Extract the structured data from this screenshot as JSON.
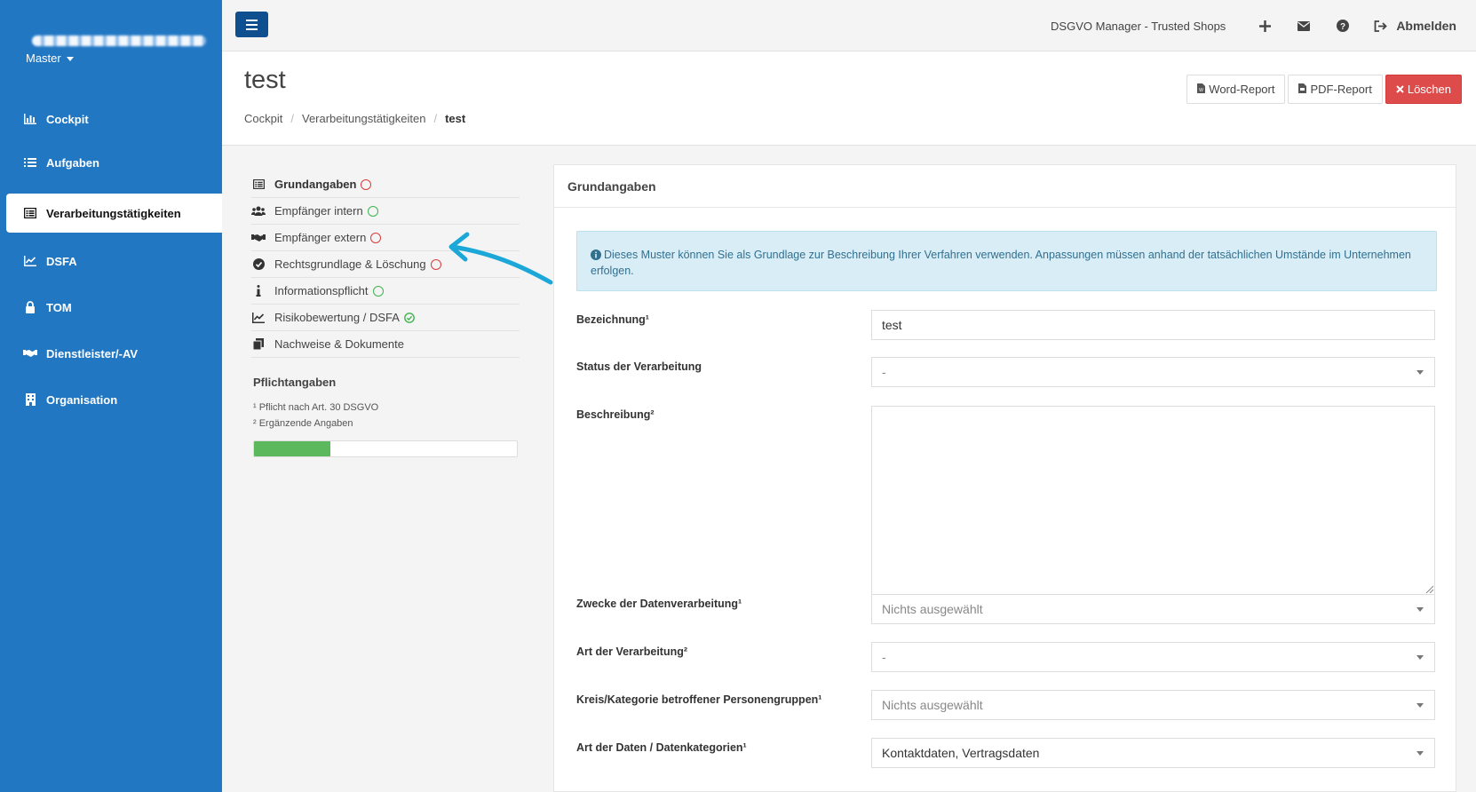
{
  "sidebar": {
    "user_menu": "Master",
    "items": [
      {
        "label": "Cockpit",
        "icon": "bar-chart-icon"
      },
      {
        "label": "Aufgaben",
        "icon": "tasks-icon"
      },
      {
        "label": "Verarbeitungstätigkeiten",
        "icon": "list-alt-icon",
        "active": true
      },
      {
        "label": "DSFA",
        "icon": "line-chart-icon"
      },
      {
        "label": "TOM",
        "icon": "lock-icon"
      },
      {
        "label": "Dienstleister/-AV",
        "icon": "handshake-icon"
      },
      {
        "label": "Organisation",
        "icon": "building-icon"
      }
    ]
  },
  "topbar": {
    "app_title": "DSGVO Manager - Trusted Shops",
    "logout_label": "Abmelden",
    "icons": [
      "plus-icon",
      "envelope-icon",
      "question-circle-icon",
      "sign-out-icon"
    ]
  },
  "header": {
    "title": "test",
    "breadcrumb": [
      "Cockpit",
      "Verarbeitungstätigkeiten",
      "test"
    ],
    "buttons": {
      "word": "Word-Report",
      "pdf": "PDF-Report",
      "delete": "Löschen"
    }
  },
  "subnav": {
    "items": [
      {
        "label": "Grundangaben",
        "status": "red",
        "icon": "list-alt-icon",
        "active": true
      },
      {
        "label": "Empfänger intern",
        "status": "green",
        "icon": "users-icon"
      },
      {
        "label": "Empfänger extern",
        "status": "red",
        "icon": "handshake-icon"
      },
      {
        "label": "Rechtsgrundlage & Löschung",
        "status": "red",
        "icon": "check-circle-icon"
      },
      {
        "label": "Informationspflicht",
        "status": "green",
        "icon": "info-icon"
      },
      {
        "label": "Risikobewertung / DSFA",
        "status": "check",
        "icon": "area-chart-icon"
      },
      {
        "label": "Nachweise & Dokumente",
        "status": "none",
        "icon": "files-icon"
      }
    ],
    "pflicht_title": "Pflichtangaben",
    "note1": "¹ Pflicht nach Art. 30 DSGVO",
    "note2": "² Ergänzende Angaben",
    "progress_percent": 29
  },
  "panel": {
    "title": "Grundangaben",
    "info": "Dieses Muster können Sie als Grundlage zur Beschreibung Ihrer Verfahren verwenden. Anpassungen müssen anhand der tatsächlichen Umstände im Unternehmen erfolgen.",
    "fields": {
      "bezeichnung_label": "Bezeichnung¹",
      "bezeichnung_value": "test",
      "status_label": "Status der Verarbeitung",
      "status_value": "-",
      "beschreibung_label": "Beschreibung²",
      "zwecke_label": "Zwecke der Datenverarbeitung¹",
      "zwecke_value": "Nichts ausgewählt",
      "art_label": "Art der Verarbeitung²",
      "art_value": "-",
      "kreis_label": "Kreis/Kategorie betroffener Personengruppen¹",
      "kreis_value": "Nichts ausgewählt",
      "daten_label": "Art der Daten / Datenkategorien¹",
      "daten_value": "Kontaktdaten, Vertragsdaten"
    }
  },
  "colors": {
    "sidebar": "#2277c3",
    "hamburger": "#0f4f8f",
    "danger": "#dd4b4b",
    "progress": "#5cb85c",
    "info_bg": "#d9edf7",
    "status_red": "#d73d3d",
    "status_green": "#3fb34f",
    "arrow": "#1ba8d8"
  }
}
